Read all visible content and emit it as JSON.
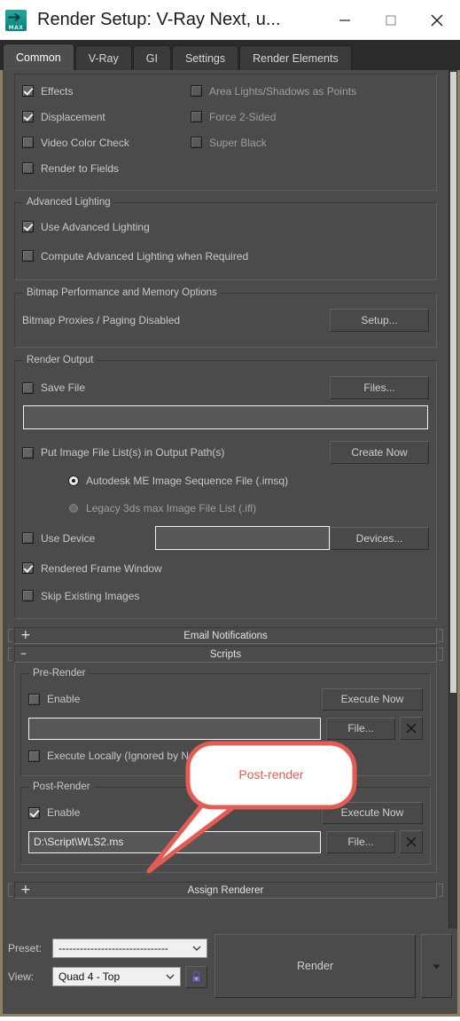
{
  "window": {
    "title": "Render Setup: V-Ray Next, u...",
    "app_icon": "3dsmax-icon",
    "minimize_label": "—",
    "maximize_label": "□",
    "close_label": "✕"
  },
  "tabs": [
    {
      "label": "Common",
      "active": true
    },
    {
      "label": "V-Ray",
      "active": false
    },
    {
      "label": "GI",
      "active": false
    },
    {
      "label": "Settings",
      "active": false
    },
    {
      "label": "Render Elements",
      "active": false
    }
  ],
  "options_group": {
    "left_checkboxes": [
      {
        "label": "Effects",
        "checked": true
      },
      {
        "label": "Displacement",
        "checked": true
      },
      {
        "label": "Video Color Check",
        "checked": false
      },
      {
        "label": "Render to Fields",
        "checked": false
      }
    ],
    "right_checkboxes": [
      {
        "label": "Area Lights/Shadows as Points",
        "checked": false
      },
      {
        "label": "Force 2-Sided",
        "checked": false
      },
      {
        "label": "Super Black",
        "checked": false
      }
    ]
  },
  "advanced_lighting": {
    "legend": "Advanced Lighting",
    "use_advanced_lighting": {
      "label": "Use Advanced Lighting",
      "checked": true
    },
    "compute_when_required": {
      "label": "Compute Advanced Lighting when Required",
      "checked": false
    }
  },
  "bitmap": {
    "legend": "Bitmap Performance and Memory Options",
    "status": "Bitmap Proxies / Paging Disabled",
    "setup_button": "Setup..."
  },
  "render_output": {
    "legend": "Render Output",
    "save_file": {
      "label": "Save File",
      "checked": false
    },
    "files_button": "Files...",
    "output_path": {
      "value": "",
      "placeholder": ""
    },
    "put_image_file_list": {
      "label": "Put Image File List(s) in Output Path(s)",
      "checked": false
    },
    "create_now_button": "Create Now",
    "radios": [
      {
        "label": "Autodesk ME Image Sequence File (.imsq)",
        "selected": true
      },
      {
        "label": "Legacy 3ds max Image File List (.ifl)",
        "selected": false
      }
    ],
    "use_device": {
      "label": "Use Device",
      "checked": false
    },
    "device_field": {
      "value": ""
    },
    "devices_button": "Devices...",
    "rendered_frame_window": {
      "label": "Rendered Frame Window",
      "checked": true
    },
    "skip_existing_images": {
      "label": "Skip Existing Images",
      "checked": false
    }
  },
  "rollouts": {
    "email_notifications": {
      "label": "Email Notifications",
      "sign": "+"
    },
    "scripts": {
      "label": "Scripts",
      "sign": "–"
    },
    "assign_renderer": {
      "label": "Assign Renderer",
      "sign": "+"
    }
  },
  "pre_render": {
    "legend": "Pre-Render",
    "enable": {
      "label": "Enable",
      "checked": false
    },
    "execute_now_button": "Execute Now",
    "script_path": {
      "value": ""
    },
    "file_button": "File...",
    "clear_button": "✕",
    "execute_locally": {
      "label": "Execute Locally (Ignored by Network Rendering)",
      "checked": false
    }
  },
  "post_render": {
    "legend": "Post-Render",
    "enable": {
      "label": "Enable",
      "checked": true
    },
    "execute_now_button": "Execute Now",
    "script_path": {
      "value": "D:\\Script\\WLS2.ms"
    },
    "file_button": "File...",
    "clear_button": "✕"
  },
  "bottom_bar": {
    "preset_label": "Preset:",
    "preset_value": "-------------------------------",
    "view_label": "View:",
    "view_value": "Quad 4 - Top",
    "lock_icon": "padlock-icon",
    "render_button": "Render",
    "render_more_icon": "chevron-down-icon"
  },
  "annotation": {
    "callout_text": "Post-render",
    "callout_color": "#e35b52",
    "callout_fill": "#ffffff"
  }
}
